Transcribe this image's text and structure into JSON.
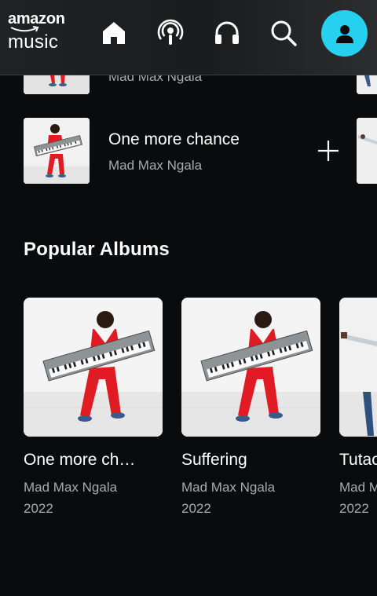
{
  "header": {
    "brand": "amazon",
    "product": "music",
    "nav": [
      {
        "icon": "home-icon",
        "label": "Home"
      },
      {
        "icon": "podcast-icon",
        "label": "Podcasts"
      },
      {
        "icon": "headphones-icon",
        "label": "Library"
      },
      {
        "icon": "search-icon",
        "label": "Search"
      },
      {
        "icon": "profile-icon",
        "label": "Profile"
      }
    ],
    "accent": "#25d1ee"
  },
  "tracks": [
    {
      "title": "",
      "artist": "Mad Max Ngala"
    },
    {
      "title": "One more chance",
      "artist": "Mad Max Ngala"
    }
  ],
  "popular_albums": {
    "heading": "Popular Albums",
    "items": [
      {
        "title": "One more ch…",
        "artist": "Mad Max Ngala",
        "year": "2022"
      },
      {
        "title": "Suffering",
        "artist": "Mad Max Ngala",
        "year": "2022"
      },
      {
        "title": "Tutac",
        "artist": "Mad M",
        "year": "2022"
      }
    ]
  },
  "colors": {
    "background": "#0a0b0c",
    "secondary_text": "#a9abad",
    "header_bg": "#1f2223"
  }
}
